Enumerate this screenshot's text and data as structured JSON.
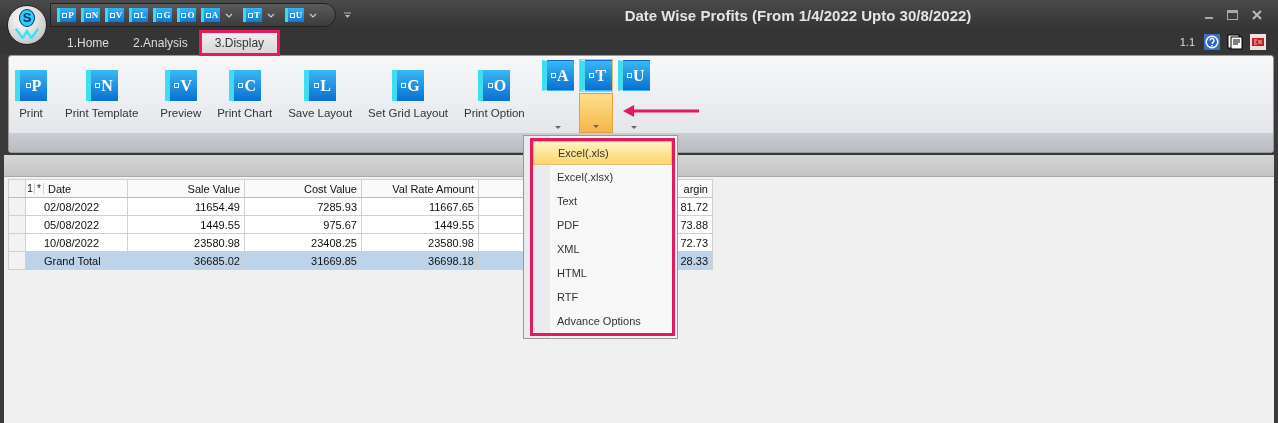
{
  "window": {
    "title": "Date Wise Profits (From 1/4/2022 Upto 30/8/2022)",
    "logo_letter": "S"
  },
  "quick_access": [
    {
      "letter": "P",
      "dropdown": false
    },
    {
      "letter": "N",
      "dropdown": false
    },
    {
      "letter": "V",
      "dropdown": false
    },
    {
      "letter": "L",
      "dropdown": false
    },
    {
      "letter": "G",
      "dropdown": false
    },
    {
      "letter": "O",
      "dropdown": false
    },
    {
      "letter": "A",
      "dropdown": true
    },
    {
      "letter": "T",
      "dropdown": true
    },
    {
      "letter": "U",
      "dropdown": true
    }
  ],
  "tabs": [
    {
      "label": "1.Home",
      "selected": false,
      "highlighted": false
    },
    {
      "label": "2.Analysis",
      "selected": false,
      "highlighted": false
    },
    {
      "label": "3.Display",
      "selected": true,
      "highlighted": true
    }
  ],
  "version": "1.1",
  "ribbon": [
    {
      "kind": "large",
      "letter": "P",
      "label": "Print"
    },
    {
      "kind": "large",
      "letter": "N",
      "label": "Print Template"
    },
    {
      "kind": "large",
      "letter": "V",
      "label": "Preview"
    },
    {
      "kind": "large",
      "letter": "C",
      "label": "Print Chart"
    },
    {
      "kind": "large",
      "letter": "L",
      "label": "Save Layout"
    },
    {
      "kind": "large",
      "letter": "G",
      "label": "Set Grid Layout"
    },
    {
      "kind": "large",
      "letter": "O",
      "label": "Print Option"
    },
    {
      "kind": "split",
      "letter": "A",
      "expanded": false
    },
    {
      "kind": "split",
      "letter": "T",
      "expanded": true
    },
    {
      "kind": "split",
      "letter": "U",
      "expanded": false
    }
  ],
  "expanded_button_arrow": true,
  "grid": {
    "header_marks": [
      "1",
      "*"
    ],
    "columns": [
      {
        "title": "Date"
      },
      {
        "title": "Sale Value"
      },
      {
        "title": "Cost Value"
      },
      {
        "title": "Val Rate Amount"
      },
      {},
      {
        "title": "argin"
      }
    ],
    "rows": [
      {
        "total": false,
        "cells": [
          "02/08/2022",
          "11654.49",
          "7285.93",
          "11667.65",
          null,
          "81.72"
        ]
      },
      {
        "total": false,
        "cells": [
          "05/08/2022",
          "1449.55",
          "975.67",
          "1449.55",
          null,
          "73.88"
        ]
      },
      {
        "total": false,
        "cells": [
          "10/08/2022",
          "23580.98",
          "23408.25",
          "23580.98",
          null,
          "72.73"
        ]
      },
      {
        "total": true,
        "cells": [
          "Grand Total",
          "36685.02",
          "31669.85",
          "36698.18",
          null,
          "28.33"
        ]
      }
    ]
  },
  "menu": {
    "highlighted": true,
    "items": [
      {
        "label": "Excel(.xls)",
        "selected": true
      },
      {
        "label": "Excel(.xlsx)",
        "selected": false
      },
      {
        "label": "Text",
        "selected": false
      },
      {
        "label": "PDF",
        "selected": false
      },
      {
        "label": "XML",
        "selected": false
      },
      {
        "label": "HTML",
        "selected": false
      },
      {
        "label": "RTF",
        "selected": false
      },
      {
        "label": "Advance Options",
        "selected": false
      }
    ]
  }
}
